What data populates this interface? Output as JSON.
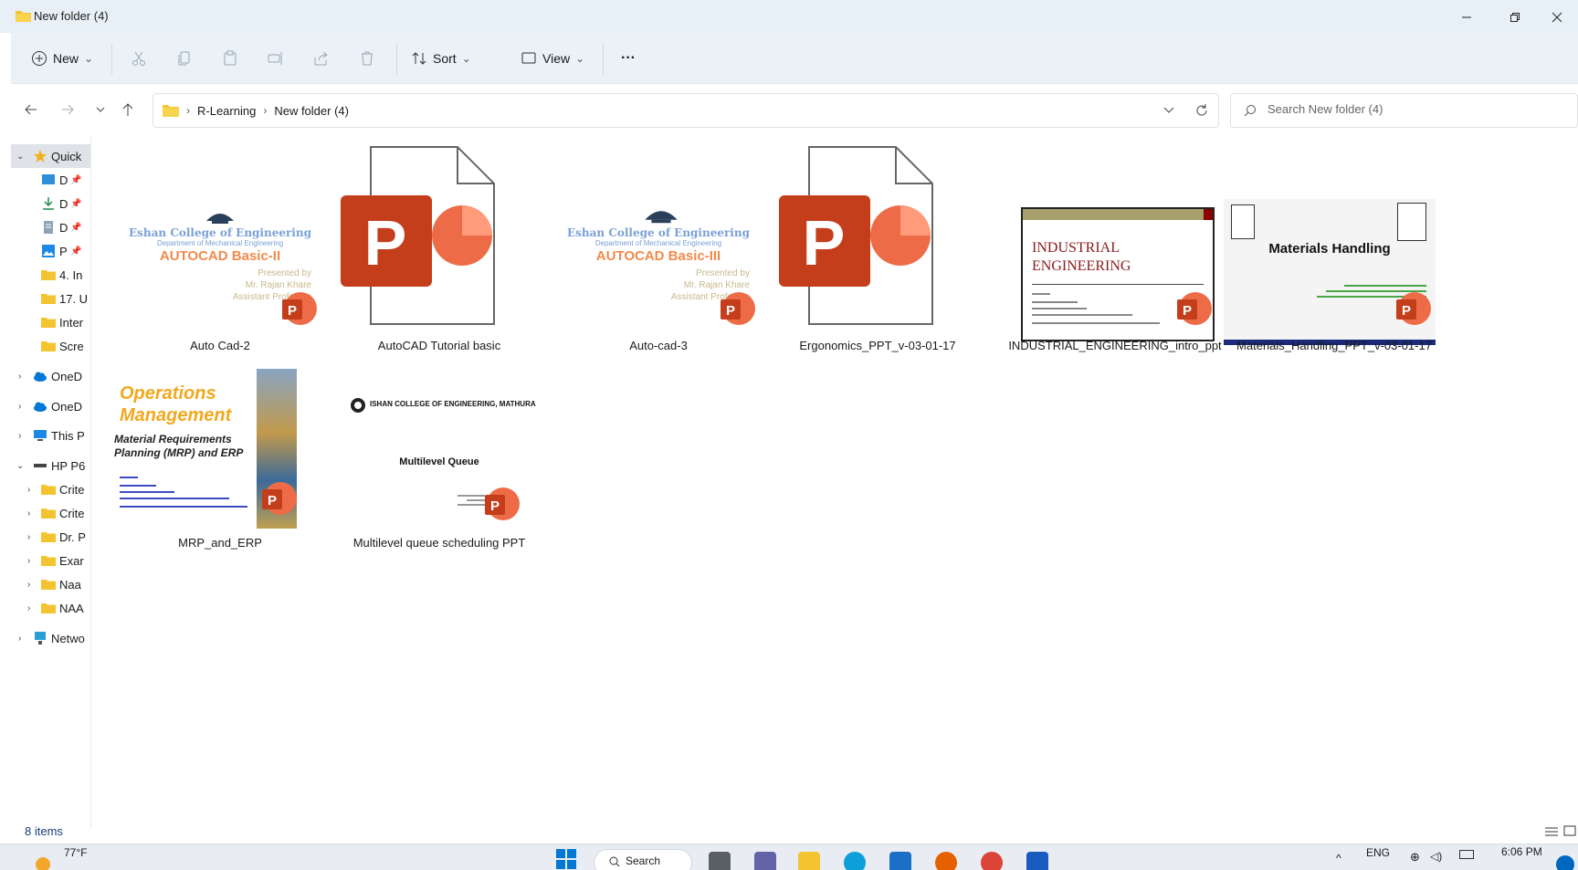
{
  "window": {
    "title": "New folder (4)"
  },
  "toolbar": {
    "new_label": "New",
    "sort_label": "Sort",
    "view_label": "View",
    "more_label": "···"
  },
  "address": {
    "crumbs": [
      "R-Learning",
      "New folder (4)"
    ]
  },
  "search": {
    "placeholder": "Search New folder (4)"
  },
  "sidebar": {
    "items": [
      {
        "label": "Quick",
        "icon": "star-icon"
      },
      {
        "label": "D",
        "icon": "desktop-icon"
      },
      {
        "label": "D",
        "icon": "download-icon"
      },
      {
        "label": "D",
        "icon": "documents-icon"
      },
      {
        "label": "P",
        "icon": "pictures-icon"
      },
      {
        "label": "4. In",
        "icon": "folder-icon"
      },
      {
        "label": "17. U",
        "icon": "folder-icon"
      },
      {
        "label": "Inter",
        "icon": "folder-icon"
      },
      {
        "label": "Scre",
        "icon": "folder-icon"
      },
      {
        "label": "OneD",
        "icon": "onedrive-icon"
      },
      {
        "label": "OneD",
        "icon": "onedrive-icon"
      },
      {
        "label": "This P",
        "icon": "pc-icon"
      },
      {
        "label": "HP P6",
        "icon": "drive-icon"
      },
      {
        "label": "Crite",
        "icon": "folder-icon"
      },
      {
        "label": "Crite",
        "icon": "folder-icon"
      },
      {
        "label": "Dr. P",
        "icon": "folder-icon"
      },
      {
        "label": "Exar",
        "icon": "folder-icon"
      },
      {
        "label": "Naa",
        "icon": "folder-icon"
      },
      {
        "label": "NAA",
        "icon": "folder-icon"
      },
      {
        "label": "Netwo",
        "icon": "network-icon"
      }
    ]
  },
  "files": [
    {
      "name": "Auto Cad-2",
      "thumb": {
        "college": "Eshan College of Engineering",
        "dept": "Department of Mechanical Engineering",
        "title": "AUTOCAD Basic-II",
        "by": "Presented by",
        "author": "Mr. Rajan Khare",
        "role": "Assistant Professor"
      }
    },
    {
      "name": "AutoCAD Tutorial basic",
      "thumb": {
        "letter": "P"
      }
    },
    {
      "name": "Auto-cad-3",
      "thumb": {
        "college": "Eshan College of Engineering",
        "dept": "Department of Mechanical Engineering",
        "title": "AUTOCAD Basic-III",
        "by": "Presented by",
        "author": "Mr. Rajan Khare",
        "role": "Assistant Professor"
      }
    },
    {
      "name": "Ergonomics_PPT_v-03-01-17",
      "thumb": {
        "letter": "P"
      }
    },
    {
      "name": "INDUSTRIAL_ENGINEERING_intro_ppt",
      "thumb": {
        "line1": "INDUSTRIAL",
        "line2": "ENGINEERING"
      }
    },
    {
      "name": "Materials_Handling_PPT_v-03-01-17",
      "thumb": {
        "title": "Materials Handling"
      }
    },
    {
      "name": "MRP_and_ERP",
      "thumb": {
        "title1": "Operations",
        "title2": "Management",
        "sub1": "Material Requirements",
        "sub2": "Planning (MRP) and ERP"
      }
    },
    {
      "name": "Multilevel queue scheduling PPT",
      "thumb": {
        "college": "ISHAN COLLEGE OF ENGINEERING, MATHURA",
        "title": "Multilevel  Queue"
      }
    }
  ],
  "status": {
    "items": "8 items"
  },
  "taskbar": {
    "temp": "77°F",
    "search_label": "Search",
    "lang": "ENG",
    "time": "6:06 PM"
  },
  "colors": {
    "ppt_red": "#c43e1c",
    "folder_yellow": "#f4c430",
    "accent": "#0067c0"
  }
}
